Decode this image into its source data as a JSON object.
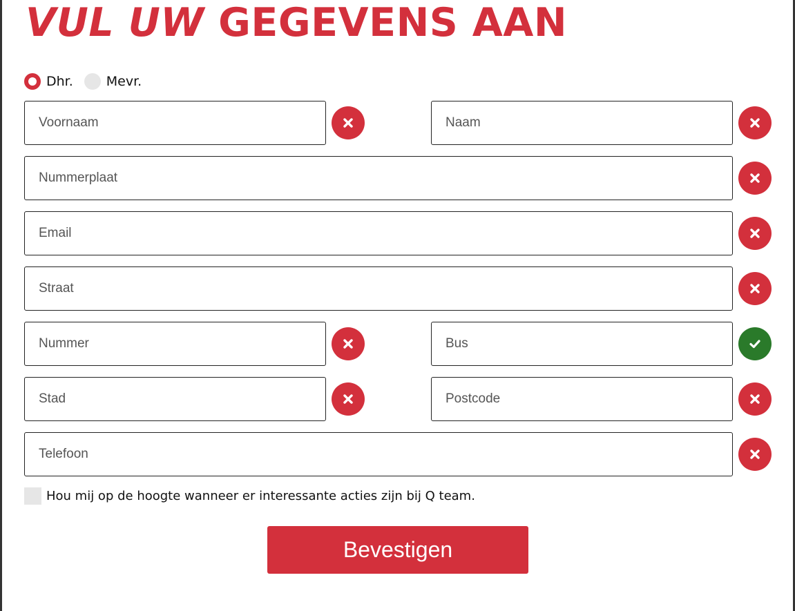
{
  "form": {
    "title_part1": "VUL UW",
    "title_part2": "GEGEVENS AAN",
    "salutation": {
      "options": [
        {
          "label": "Dhr.",
          "selected": true
        },
        {
          "label": "Mevr.",
          "selected": false
        }
      ]
    },
    "fields": {
      "voornaam": {
        "placeholder": "Voornaam",
        "value": "",
        "status": "error"
      },
      "naam": {
        "placeholder": "Naam",
        "value": "",
        "status": "error"
      },
      "nummerplaat": {
        "placeholder": "Nummerplaat",
        "value": "",
        "status": "error"
      },
      "email": {
        "placeholder": "Email",
        "value": "",
        "status": "error"
      },
      "straat": {
        "placeholder": "Straat",
        "value": "",
        "status": "error"
      },
      "nummer": {
        "placeholder": "Nummer",
        "value": "",
        "status": "error"
      },
      "bus": {
        "placeholder": "Bus",
        "value": "",
        "status": "valid"
      },
      "stad": {
        "placeholder": "Stad",
        "value": "",
        "status": "error"
      },
      "postcode": {
        "placeholder": "Postcode",
        "value": "",
        "status": "error"
      },
      "telefoon": {
        "placeholder": "Telefoon",
        "value": "",
        "status": "error"
      }
    },
    "optin_label": "Hou mij op de hoogte wanneer er interessante acties zijn bij Q team.",
    "optin_checked": false,
    "submit_label": "Bevestigen"
  },
  "colors": {
    "accent": "#d3303c",
    "valid": "#2a7a2a",
    "unchecked": "#e6e6e6"
  },
  "icons": {
    "error": "close-icon",
    "valid": "check-icon"
  }
}
